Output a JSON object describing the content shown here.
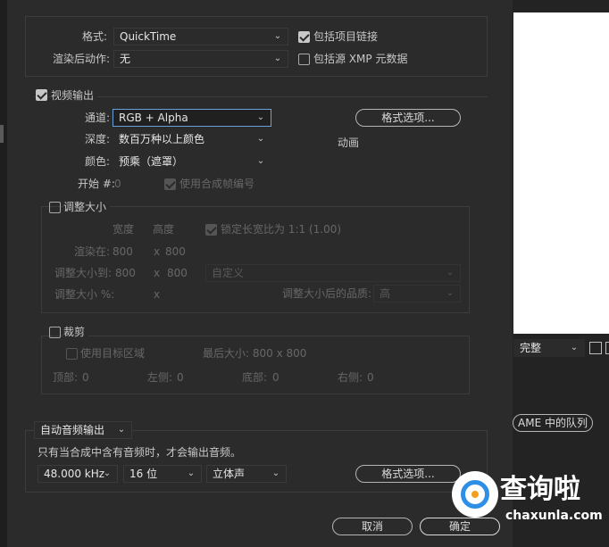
{
  "format": {
    "label": "格式:",
    "value": "QuickTime"
  },
  "post_render": {
    "label": "渲染后动作:",
    "value": "无"
  },
  "include_project_link": {
    "label": "包括项目链接",
    "checked": true
  },
  "include_xmp": {
    "label": "包括源 XMP 元数据",
    "checked": false
  },
  "video_output": {
    "label": "视频输出",
    "checked": true
  },
  "channels": {
    "label": "通道:",
    "value": "RGB + Alpha"
  },
  "depth": {
    "label": "深度:",
    "value": "数百万种以上颜色"
  },
  "color": {
    "label": "颜色:",
    "value": "预乘（遮罩）"
  },
  "format_options_label": "格式选项...",
  "codec_label": "动画",
  "start": {
    "label": "开始 #:",
    "value": "0"
  },
  "use_comp_frame": {
    "label": "使用合成帧编号",
    "checked": true
  },
  "resize": {
    "label": "调整大小",
    "checked": false,
    "width_header": "宽度",
    "height_header": "高度",
    "lock_label": "锁定长宽比为 1:1 (1.00)",
    "rendering_at_label": "渲染在:",
    "rendering_at_w": "800",
    "rendering_at_h": "800",
    "resize_to_label": "调整大小到:",
    "resize_to_w": "800",
    "resize_to_h": "800",
    "x_sep": "x",
    "preset_value": "自定义",
    "resize_pct_label": "调整大小 %:",
    "quality_label": "调整大小后的品质:",
    "quality_value": "高"
  },
  "crop": {
    "label": "裁剪",
    "checked": false,
    "use_roi_label": "使用目标区域",
    "final_size_label": "最后大小: 800 x 800",
    "top_label": "顶部:",
    "top_value": "0",
    "left_label": "左侧:",
    "left_value": "0",
    "bottom_label": "底部:",
    "bottom_value": "0",
    "right_label": "右侧:",
    "right_value": "0"
  },
  "audio": {
    "mode": "自动音频输出",
    "note": "只有当合成中含有音频时，才会输出音频。",
    "rate": "48.000 kHz",
    "bits": "16 位",
    "channels": "立体声",
    "format_options_label": "格式选项..."
  },
  "cancel_label": "取消",
  "ok_label": "确定",
  "right_panel": {
    "quality_value": "完整",
    "queue_button": "AME 中的队列"
  },
  "watermark": {
    "text_cn": "查询啦",
    "text_url": "chaxunla.com"
  },
  "colors": {
    "dialog_bg": "#2b2b2b",
    "accent_focus": "#6f9fd8",
    "watermark_blue": "#2d8fe6"
  }
}
